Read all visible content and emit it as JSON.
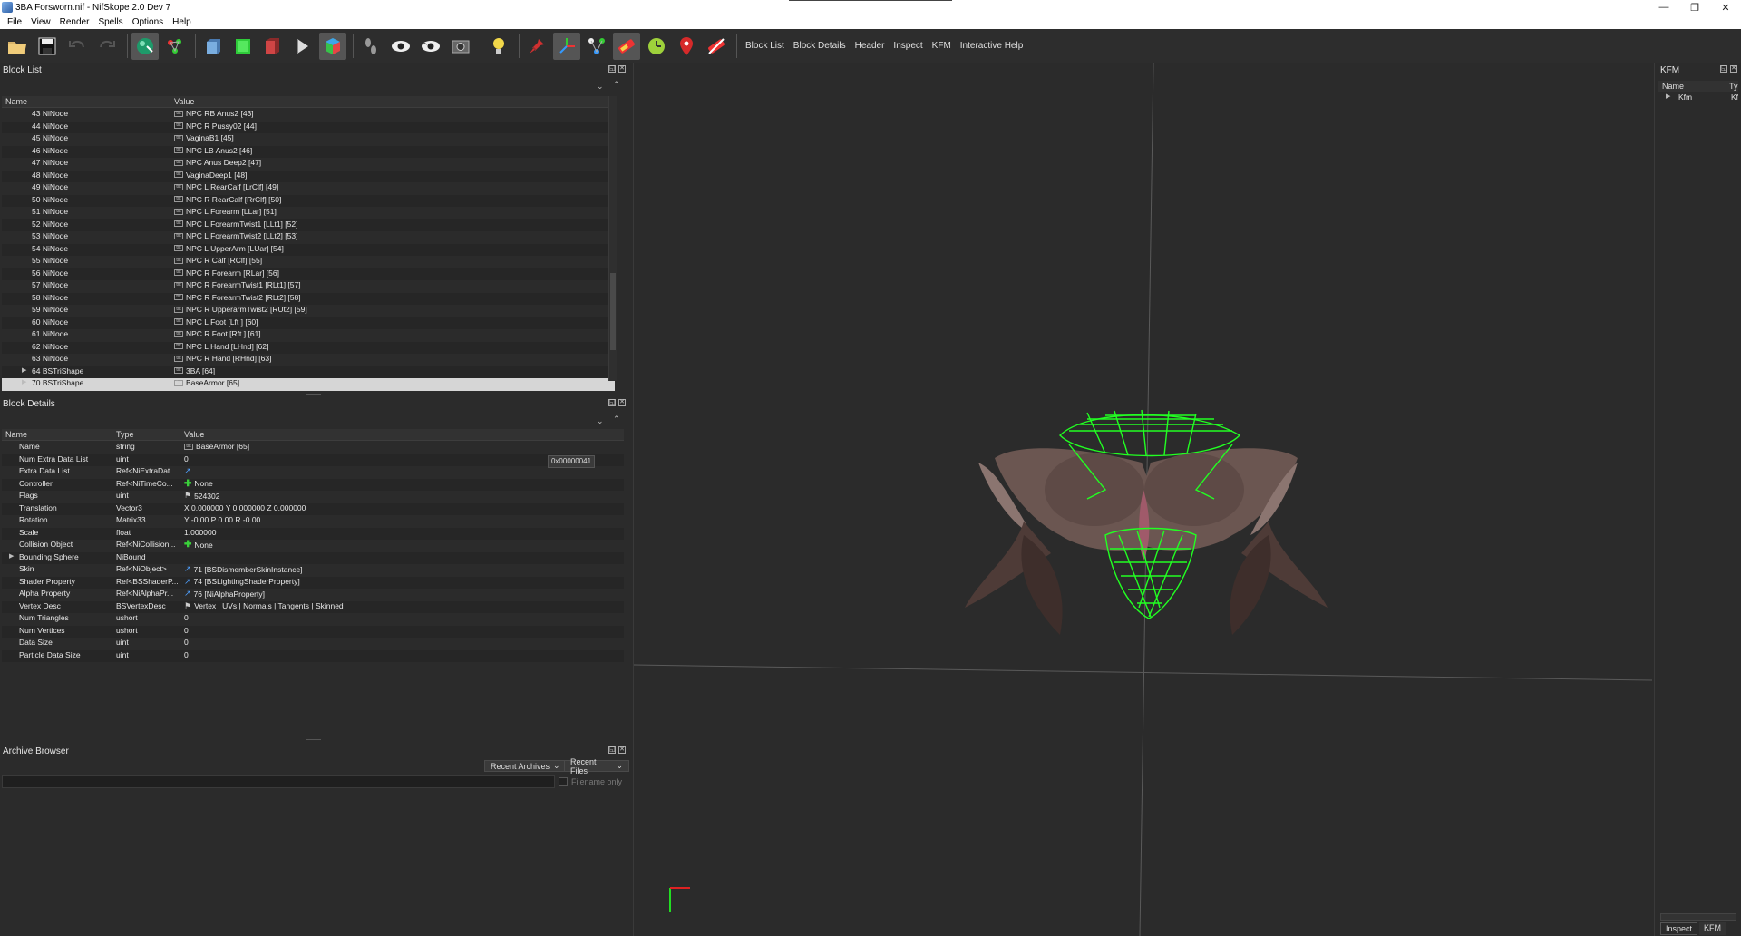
{
  "window": {
    "title": "3BA Forsworn.nif - NifSkope 2.0 Dev 7",
    "controls": [
      "—",
      "❐",
      "✕"
    ]
  },
  "menu": [
    "File",
    "View",
    "Render",
    "Spells",
    "Options",
    "Help"
  ],
  "toolbar": {
    "text_buttons": [
      "Block List",
      "Block Details",
      "Header",
      "Inspect",
      "KFM",
      "Interactive Help"
    ]
  },
  "block_list": {
    "title": "Block List",
    "columns": [
      "Name",
      "Value"
    ],
    "rows": [
      {
        "name": "43 NiNode",
        "value": "NPC RB Anus2 [43]"
      },
      {
        "name": "44 NiNode",
        "value": "NPC R Pussy02 [44]"
      },
      {
        "name": "45 NiNode",
        "value": "VaginaB1 [45]"
      },
      {
        "name": "46 NiNode",
        "value": "NPC LB Anus2 [46]"
      },
      {
        "name": "47 NiNode",
        "value": "NPC Anus Deep2 [47]"
      },
      {
        "name": "48 NiNode",
        "value": "VaginaDeep1 [48]"
      },
      {
        "name": "49 NiNode",
        "value": "NPC L RearCalf [LrClf] [49]"
      },
      {
        "name": "50 NiNode",
        "value": "NPC R RearCalf [RrClf] [50]"
      },
      {
        "name": "51 NiNode",
        "value": "NPC L Forearm [LLar] [51]"
      },
      {
        "name": "52 NiNode",
        "value": "NPC L ForearmTwist1 [LLt1] [52]"
      },
      {
        "name": "53 NiNode",
        "value": "NPC L ForearmTwist2 [LLt2] [53]"
      },
      {
        "name": "54 NiNode",
        "value": "NPC L UpperArm [LUar] [54]"
      },
      {
        "name": "55 NiNode",
        "value": "NPC R Calf [RClf] [55]"
      },
      {
        "name": "56 NiNode",
        "value": "NPC R Forearm [RLar] [56]"
      },
      {
        "name": "57 NiNode",
        "value": "NPC R ForearmTwist1 [RLt1] [57]"
      },
      {
        "name": "58 NiNode",
        "value": "NPC R ForearmTwist2 [RLt2] [58]"
      },
      {
        "name": "59 NiNode",
        "value": "NPC R UpperarmTwist2 [RUt2] [59]"
      },
      {
        "name": "60 NiNode",
        "value": "NPC L Foot [Lft ] [60]"
      },
      {
        "name": "61 NiNode",
        "value": "NPC R Foot [Rft ] [61]"
      },
      {
        "name": "62 NiNode",
        "value": "NPC L Hand [LHnd] [62]"
      },
      {
        "name": "63 NiNode",
        "value": "NPC R Hand [RHnd] [63]"
      },
      {
        "name": "64 BSTriShape",
        "value": "3BA [64]"
      },
      {
        "name": "70 BSTriShape",
        "value": "BaseArmor [65]"
      }
    ]
  },
  "block_details": {
    "title": "Block Details",
    "columns": [
      "Name",
      "Type",
      "Value"
    ],
    "tooltip": "0x00000041",
    "rows": [
      {
        "name": "Name",
        "type": "string",
        "value": "BaseArmor [65]"
      },
      {
        "name": "Num Extra Data List",
        "type": "uint",
        "value": "0"
      },
      {
        "name": "Extra Data List",
        "type": "Ref<NiExtraDat...",
        "value": ""
      },
      {
        "name": "Controller",
        "type": "Ref<NiTimeCo...",
        "value": "None"
      },
      {
        "name": "Flags",
        "type": "uint",
        "value": "524302"
      },
      {
        "name": "Translation",
        "type": "Vector3",
        "value": "X 0.000000 Y 0.000000 Z 0.000000"
      },
      {
        "name": "Rotation",
        "type": "Matrix33",
        "value": "Y -0.00 P 0.00 R -0.00"
      },
      {
        "name": "Scale",
        "type": "float",
        "value": "1.000000"
      },
      {
        "name": "Collision Object",
        "type": "Ref<NiCollision...",
        "value": "None"
      },
      {
        "name": "Bounding Sphere",
        "type": "NiBound",
        "value": ""
      },
      {
        "name": "Skin",
        "type": "Ref<NiObject>",
        "value": "71 [BSDismemberSkinInstance]"
      },
      {
        "name": "Shader Property",
        "type": "Ref<BSShaderP...",
        "value": "74 [BSLightingShaderProperty]"
      },
      {
        "name": "Alpha Property",
        "type": "Ref<NiAlphaPr...",
        "value": "76 [NiAlphaProperty]"
      },
      {
        "name": "Vertex Desc",
        "type": "BSVertexDesc",
        "value": "Vertex | UVs | Normals | Tangents | Skinned"
      },
      {
        "name": "Num Triangles",
        "type": "ushort",
        "value": "0"
      },
      {
        "name": "Num Vertices",
        "type": "ushort",
        "value": "0"
      },
      {
        "name": "Data Size",
        "type": "uint",
        "value": "0"
      },
      {
        "name": "Particle Data Size",
        "type": "uint",
        "value": "0"
      }
    ]
  },
  "archive_browser": {
    "title": "Archive Browser",
    "recent_archives": "Recent Archives",
    "recent_files": "Recent Files",
    "filename_only": "Filename only",
    "search_value": ""
  },
  "kfm": {
    "title": "KFM",
    "columns": [
      "Name",
      "Ty"
    ],
    "rows": [
      {
        "name": "Kfm",
        "type": "Kf"
      }
    ],
    "tabs": [
      "Inspect",
      "KFM"
    ]
  },
  "colors": {
    "background": "#2b2b2b",
    "wireframe": "#22ff22",
    "selection": "#d6d6d6"
  }
}
